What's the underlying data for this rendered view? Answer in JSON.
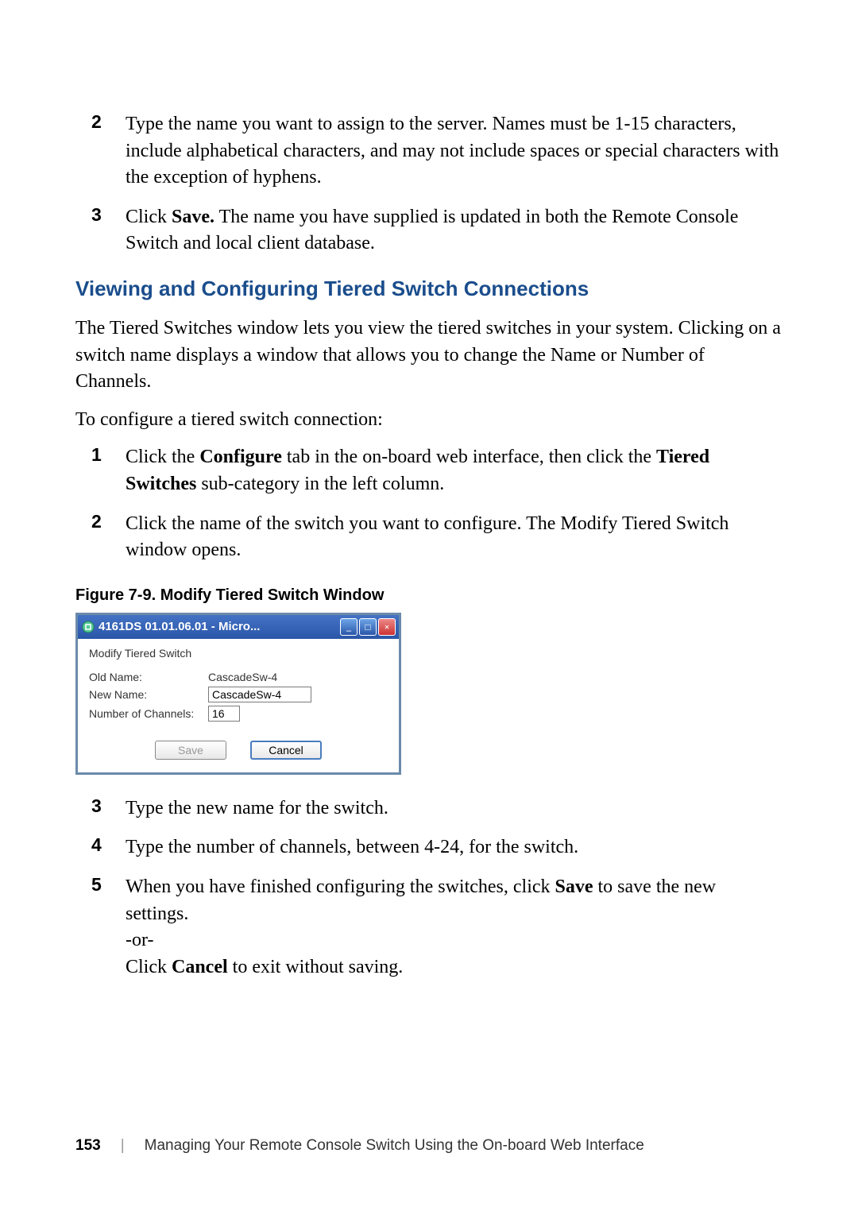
{
  "steps_top": [
    {
      "num": "2",
      "text": "Type the name you want to assign to the server. Names must be 1-15 characters, include alphabetical characters, and may not include spaces or special characters with the exception of hyphens."
    },
    {
      "num": "3",
      "prefix": "Click ",
      "bold": "Save.",
      "suffix": " The name you have supplied is updated in both the Remote Console Switch and local client database."
    }
  ],
  "section_heading": "Viewing and Configuring Tiered Switch Connections",
  "para1": "The Tiered Switches window lets you view the tiered switches in your system. Clicking on a switch name displays a window that allows you to change the Name or Number of Channels.",
  "para2": "To configure a tiered switch connection:",
  "steps_mid": [
    {
      "num": "1",
      "prefix": "Click the ",
      "bold": "Configure",
      "mid": " tab in the on-board web interface, then click the ",
      "bold2": "Tiered Switches",
      "suffix": " sub-category in the left column."
    },
    {
      "num": "2",
      "text": "Click the name of the switch you want to configure. The Modify Tiered Switch window opens."
    }
  ],
  "figure_caption": "Figure 7-9.    Modify Tiered Switch Window",
  "dialog": {
    "title": "4161DS 01.01.06.01 - Micro...",
    "subtitle": "Modify Tiered Switch",
    "old_name_label": "Old Name:",
    "old_name_value": "CascadeSw-4",
    "new_name_label": "New Name:",
    "new_name_value": "CascadeSw-4",
    "channels_label": "Number of Channels:",
    "channels_value": "16",
    "save_label": "Save",
    "cancel_label": "Cancel"
  },
  "steps_bottom": [
    {
      "num": "3",
      "text": "Type the new name for the switch."
    },
    {
      "num": "4",
      "text": "Type the number of channels, between 4-24, for the switch."
    },
    {
      "num": "5",
      "prefix": "When you have finished configuring the switches, click ",
      "bold": "Save",
      "suffix": " to save the new settings.",
      "line2": "-or-",
      "line3_prefix": "Click ",
      "line3_bold": "Cancel",
      "line3_suffix": " to exit without saving."
    }
  ],
  "footer": {
    "page": "153",
    "text": "Managing Your Remote Console Switch Using the On-board Web Interface"
  }
}
